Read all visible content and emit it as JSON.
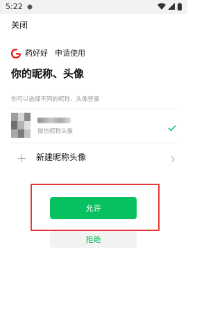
{
  "status_bar": {
    "time": "5:22",
    "icons": [
      "notification-dot-icon",
      "wifi-icon",
      "signal-icon",
      "battery-icon"
    ]
  },
  "header": {
    "close_label": "关闭"
  },
  "app": {
    "name": "药好好",
    "request_label": "申请使用",
    "logo_icon": "yaohaohao-logo-icon",
    "logo_color": "#e0251b"
  },
  "page": {
    "title": "你的昵称、头像",
    "hint": "你可以选择不同的昵称、头像登录"
  },
  "profile_option": {
    "subtitle": "微信昵称头像",
    "selected": true,
    "check_icon": "check-icon"
  },
  "new_option": {
    "label": "新建昵称头像",
    "leading_icon": "plus-icon",
    "trailing_icon": "chevron-right-icon"
  },
  "actions": {
    "allow_label": "允许",
    "reject_label": "拒绝"
  },
  "colors": {
    "accent": "#07c160",
    "highlight": "#e53935"
  }
}
